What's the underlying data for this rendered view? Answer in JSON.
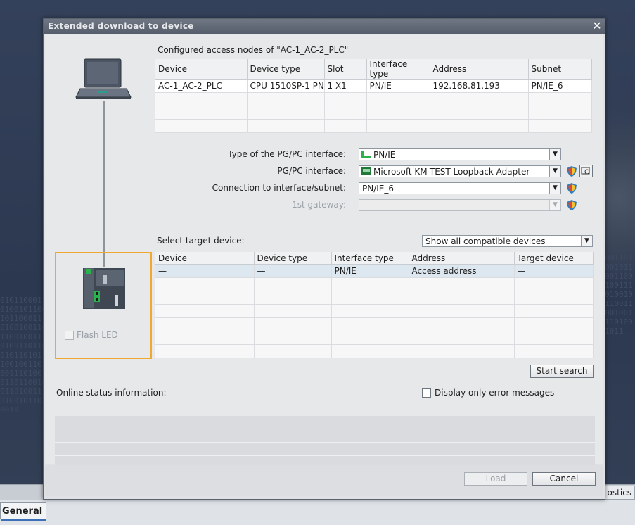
{
  "dialog": {
    "title": "Extended download to device",
    "close": "✕"
  },
  "configured": {
    "heading": "Configured access nodes of \"AC-1_AC-2_PLC\"",
    "columns": [
      "Device",
      "Device type",
      "Slot",
      "Interface type",
      "Address",
      "Subnet"
    ],
    "rows": [
      [
        "AC-1_AC-2_PLC",
        "CPU 1510SP-1 PN",
        "1 X1",
        "PN/IE",
        "192.168.81.193",
        "PN/IE_6"
      ]
    ]
  },
  "interface": {
    "type_label": "Type of the PG/PC interface:",
    "type_value": "PN/IE",
    "pgpc_label": "PG/PC interface:",
    "pgpc_value": "Microsoft KM-TEST Loopback Adapter",
    "conn_label": "Connection to interface/subnet:",
    "conn_value": "PN/IE_6",
    "gateway_label": "1st gateway:",
    "gateway_value": ""
  },
  "target": {
    "heading": "Select target device:",
    "filter_value": "Show all compatible devices",
    "columns": [
      "Device",
      "Device type",
      "Interface type",
      "Address",
      "Target device"
    ],
    "rows": [
      [
        "—",
        "—",
        "PN/IE",
        "Access address",
        "—"
      ]
    ]
  },
  "flash_led": "Flash LED",
  "start_search": "Start search",
  "online_status_label": "Online status information:",
  "error_only_label": "Display only error messages",
  "load_button": "Load",
  "cancel_button": "Cancel",
  "bottom": {
    "tab_general": "General",
    "tab_diagnostics": "ostics"
  },
  "colors": {
    "highlight_border": "#f0a830",
    "selected_row": "#dde7ef",
    "titlebar": "#5f6774"
  }
}
